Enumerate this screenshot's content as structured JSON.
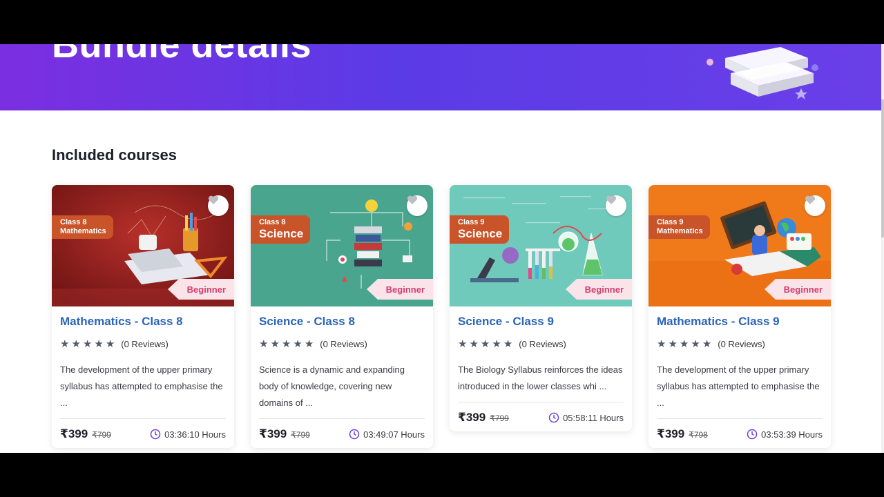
{
  "hero": {
    "title": "Bundle details"
  },
  "section": {
    "title": "Included courses"
  },
  "cards": [
    {
      "tag_sub": "Class 8",
      "tag_main": "Mathematics",
      "level": "Beginner",
      "title": "Mathematics - Class 8",
      "reviews": "(0 Reviews)",
      "rating": 5,
      "description": "The development of the upper primary syllabus has attempted to emphasise the ...",
      "price": "₹399",
      "old_price": "₹799",
      "duration": "03:36:10 Hours",
      "theme_color": "#8e1f1f"
    },
    {
      "tag_sub": "Class 8",
      "tag_main": "Science",
      "level": "Beginner",
      "title": "Science - Class 8",
      "reviews": "(0 Reviews)",
      "rating": 5,
      "description": "Science is a dynamic and expanding body of knowledge, covering new domains of ...",
      "price": "₹399",
      "old_price": "₹799",
      "duration": "03:49:07 Hours",
      "theme_color": "#4aa58e"
    },
    {
      "tag_sub": "Class 9",
      "tag_main": "Science",
      "level": "Beginner",
      "title": "Science - Class 9",
      "reviews": "(0 Reviews)",
      "rating": 5,
      "description": "The Biology Syllabus reinforces the ideas introduced in the lower classes whi ...",
      "price": "₹399",
      "old_price": "₹799",
      "duration": "05:58:11 Hours",
      "theme_color": "#6fcabb"
    },
    {
      "tag_sub": "Class 9",
      "tag_main": "Mathematics",
      "level": "Beginner",
      "title": "Mathematics - Class 9",
      "reviews": "(0 Reviews)",
      "rating": 5,
      "description": "The development of the upper primary syllabus has attempted to emphasise the ...",
      "price": "₹399",
      "old_price": "₹798",
      "duration": "03:53:39 Hours",
      "theme_color": "#f07a1a"
    }
  ],
  "icons": {
    "favorite": "heart-icon",
    "rating": "star-icon",
    "duration": "clock-icon"
  },
  "colors": {
    "hero_start": "#7b2fe0",
    "hero_end": "#6a3fe8",
    "title_blue": "#2b64b8",
    "tag_orange": "#c9542a",
    "level_pink": "#d0416e"
  }
}
